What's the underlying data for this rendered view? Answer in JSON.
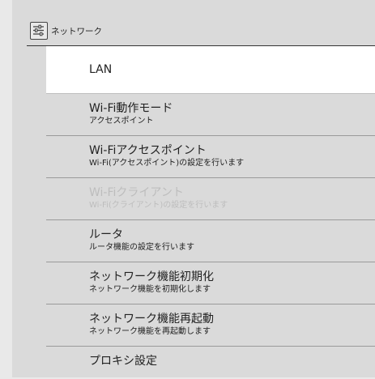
{
  "header": {
    "title": "ネットワーク"
  },
  "menu": {
    "items": [
      {
        "title": "LAN"
      },
      {
        "title": "Wi-Fi動作モード",
        "subtitle": "アクセスポイント"
      },
      {
        "title": "Wi-Fiアクセスポイント",
        "subtitle": "Wi-Fi(アクセスポイント)の設定を行います"
      },
      {
        "title": "Wi-Fiクライアント",
        "subtitle": "Wi-Fi(クライアント)の設定を行います"
      },
      {
        "title": "ルータ",
        "subtitle": "ルータ機能の設定を行います"
      },
      {
        "title": "ネットワーク機能初期化",
        "subtitle": "ネットワーク機能を初期化します"
      },
      {
        "title": "ネットワーク機能再起動",
        "subtitle": "ネットワーク機能を再起動します"
      },
      {
        "title": "プロキシ設定"
      }
    ]
  },
  "colors": {
    "background": "#e9e9e9",
    "panel": "#dadada",
    "selected": "#ffffff",
    "disabled_text": "#bdbdbd"
  },
  "icons": [
    "settings-sliders-icon"
  ]
}
